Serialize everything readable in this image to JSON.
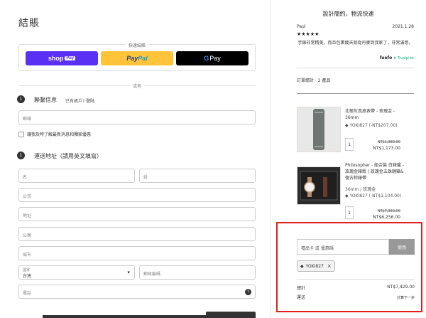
{
  "checkout": {
    "title": "結賬",
    "express_label": "快速結賬",
    "shoppay": {
      "label": "shop",
      "tag": "Pay"
    },
    "paypal": {
      "pay": "Pay",
      "pal": "Pal"
    },
    "gpay": {
      "g": "G",
      "label": "Pay"
    },
    "or_label": "或者",
    "contact": {
      "step": "1",
      "title": "聯繫信息",
      "has_account": "已有帳戶?",
      "login_link": "登陆",
      "email_placeholder": "郵箱",
      "newsletter_label": "讓我及時了解最新消息和獨家優惠"
    },
    "shipping": {
      "step": "1",
      "title": "運送地址（請用英文填寫）",
      "first_name": "名",
      "last_name": "姓",
      "company": "公司",
      "address": "地址",
      "apartment": "公寓",
      "city": "城市",
      "country_label": "國家",
      "country_value": "台灣",
      "postal_code": "郵政編碼",
      "phone": "電話"
    }
  },
  "sidebar": {
    "tagline": "設計簡約，物流快速",
    "review": {
      "name": "Paul",
      "date": "2021.1.28",
      "stars": "★★★★★",
      "text": "手錶非常精美，而且包裹幾天就從丹麥到我家了，非常滿意。",
      "source": "feefo",
      "trustpilot": "★ Trustpilot"
    },
    "cart_total": "訂單總計 · 2 產品",
    "items": [
      {
        "name": "北極灰真皮表帶 - 玫瑰金 - 36mm",
        "code": "YOKI827 (-NT$207.00)",
        "qty": "1",
        "price_old": "NT$1,380.00",
        "price_new": "NT$1,173.00"
      },
      {
        "name": "Philosopher - 組合裝 白錶盤 - 玫瑰金錶殼 | 玫瑰金五珠鏈錶&復古棕錶帶",
        "variant": "36mm / 玫瑰金",
        "code": "YOKI827 (-NT$1,104.00)",
        "qty": "1",
        "price_old": "NT$7,360.00",
        "price_new": "NT$6,256.00"
      }
    ],
    "gift": {
      "placeholder": "禮品卡 或 優惠碼",
      "apply": "使用"
    },
    "coupon": {
      "code": "YOKI827",
      "remove": "×"
    },
    "summary": {
      "subtotal_label": "總計",
      "subtotal_value": "NT$7,429.00",
      "shipping_label": "運送",
      "shipping_value": "計算下一步"
    }
  },
  "colors": {
    "shoppay": "#5a31f4",
    "paypal": "#ffc439",
    "highlight": "#e02020"
  }
}
